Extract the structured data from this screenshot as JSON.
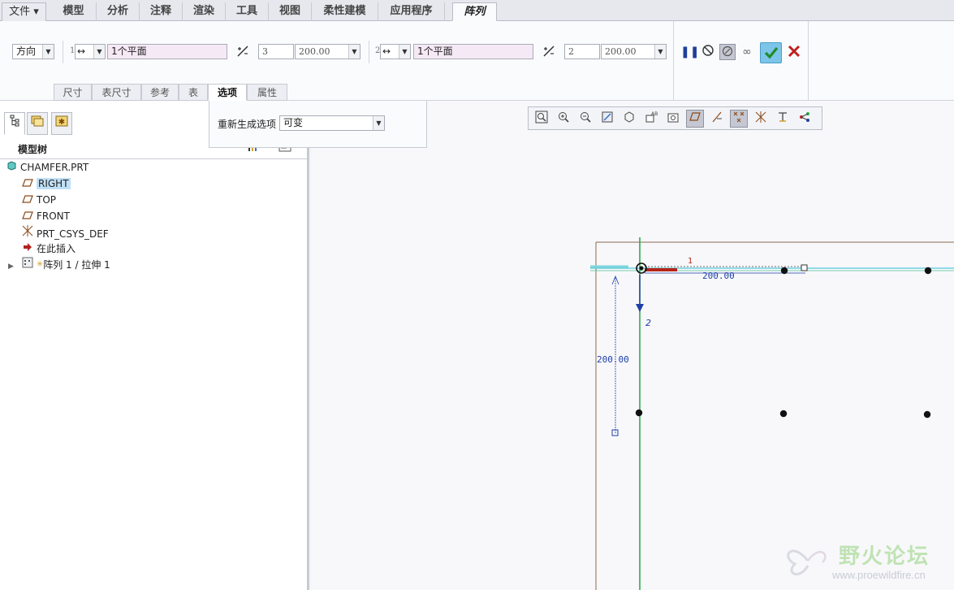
{
  "ribbon_tabs": {
    "file": "文件",
    "items": [
      "模型",
      "分析",
      "注释",
      "渲染",
      "工具",
      "视图",
      "柔性建模",
      "应用程序"
    ],
    "active": "阵列"
  },
  "pattern": {
    "type_select": "方向",
    "dir1": {
      "index": "1",
      "reference": "1个平面",
      "count": "3",
      "spacing": "200.00"
    },
    "dir2": {
      "index": "2",
      "reference": "1个平面",
      "count": "2",
      "spacing": "200.00"
    }
  },
  "sub_tabs": [
    "尺寸",
    "表尺寸",
    "参考",
    "表",
    "选项",
    "属性"
  ],
  "options_panel": {
    "label": "重新生成选项",
    "value": "可变"
  },
  "model_tree": {
    "title": "模型树",
    "items": [
      {
        "label": "CHAMFER.PRT",
        "icon": "part-icon"
      },
      {
        "label": "RIGHT",
        "icon": "datum-plane-icon",
        "selected": true
      },
      {
        "label": "TOP",
        "icon": "datum-plane-icon"
      },
      {
        "label": "FRONT",
        "icon": "datum-plane-icon"
      },
      {
        "label": "PRT_CSYS_DEF",
        "icon": "csys-icon"
      },
      {
        "label": "在此插入",
        "icon": "insert-arrow-icon"
      },
      {
        "label": "阵列 1 / 拉伸 1",
        "icon": "pattern-icon"
      }
    ]
  },
  "canvas": {
    "dim_h": "200.00",
    "dim_v": "200.00",
    "label_dir1": "1",
    "label_dir2": "2"
  },
  "watermark": {
    "title": "野火论坛",
    "url": "www.proewildfire.cn"
  },
  "colors": {
    "accent_confirm": "#2e9c3a",
    "cancel": "#c0211f",
    "selected_bg": "#bfe0f7",
    "dir1_arrow": "#b52418",
    "dir2_arrow": "#1d3fa6",
    "datum_green": "#2cae4a",
    "part_edge": "#8a6a4f"
  }
}
